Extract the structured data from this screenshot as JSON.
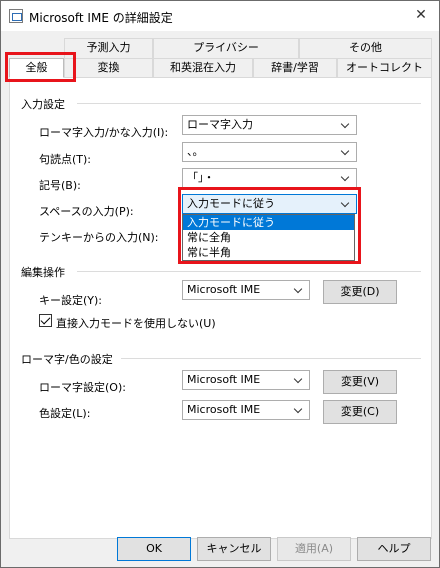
{
  "window": {
    "title": "Microsoft IME の詳細設定",
    "close_glyph": "✕"
  },
  "tabs": {
    "row1": [
      "予測入力",
      "プライバシー",
      "その他"
    ],
    "row2": [
      "全般",
      "変換",
      "和英混在入力",
      "辞書/学習",
      "オートコレクト"
    ],
    "active": "全般"
  },
  "input_settings": {
    "title": "入力設定",
    "romaji_kana": {
      "label": "ローマ字入力/かな入力(I):",
      "value": "ローマ字入力"
    },
    "punctuation": {
      "label": "句読点(T):",
      "value": "、。"
    },
    "symbols": {
      "label": "記号(B):",
      "value": "「」・"
    },
    "space": {
      "label": "スペースの入力(P):",
      "value": "入力モードに従う",
      "options": [
        "入力モードに従う",
        "常に全角",
        "常に半角"
      ],
      "selected_index": 0
    },
    "tenkey": {
      "label": "テンキーからの入力(N):"
    }
  },
  "edit_ops": {
    "title": "編集操作",
    "key_setting": {
      "label": "キー設定(Y):",
      "value": "Microsoft IME",
      "change_label": "変更(D)"
    },
    "direct_input": {
      "label": "直接入力モードを使用しない(U)",
      "checked": true
    }
  },
  "romaji_color": {
    "title": "ローマ字/色の設定",
    "romaji_setting": {
      "label": "ローマ字設定(O):",
      "value": "Microsoft IME",
      "change_label": "変更(V)"
    },
    "color_setting": {
      "label": "色設定(L):",
      "value": "Microsoft IME",
      "change_label": "変更(C)"
    }
  },
  "footer": {
    "ok": "OK",
    "cancel": "キャンセル",
    "apply": "適用(A)",
    "help": "ヘルプ"
  },
  "colors": {
    "accent": "#0078d7",
    "highlight": "#e8141b"
  }
}
